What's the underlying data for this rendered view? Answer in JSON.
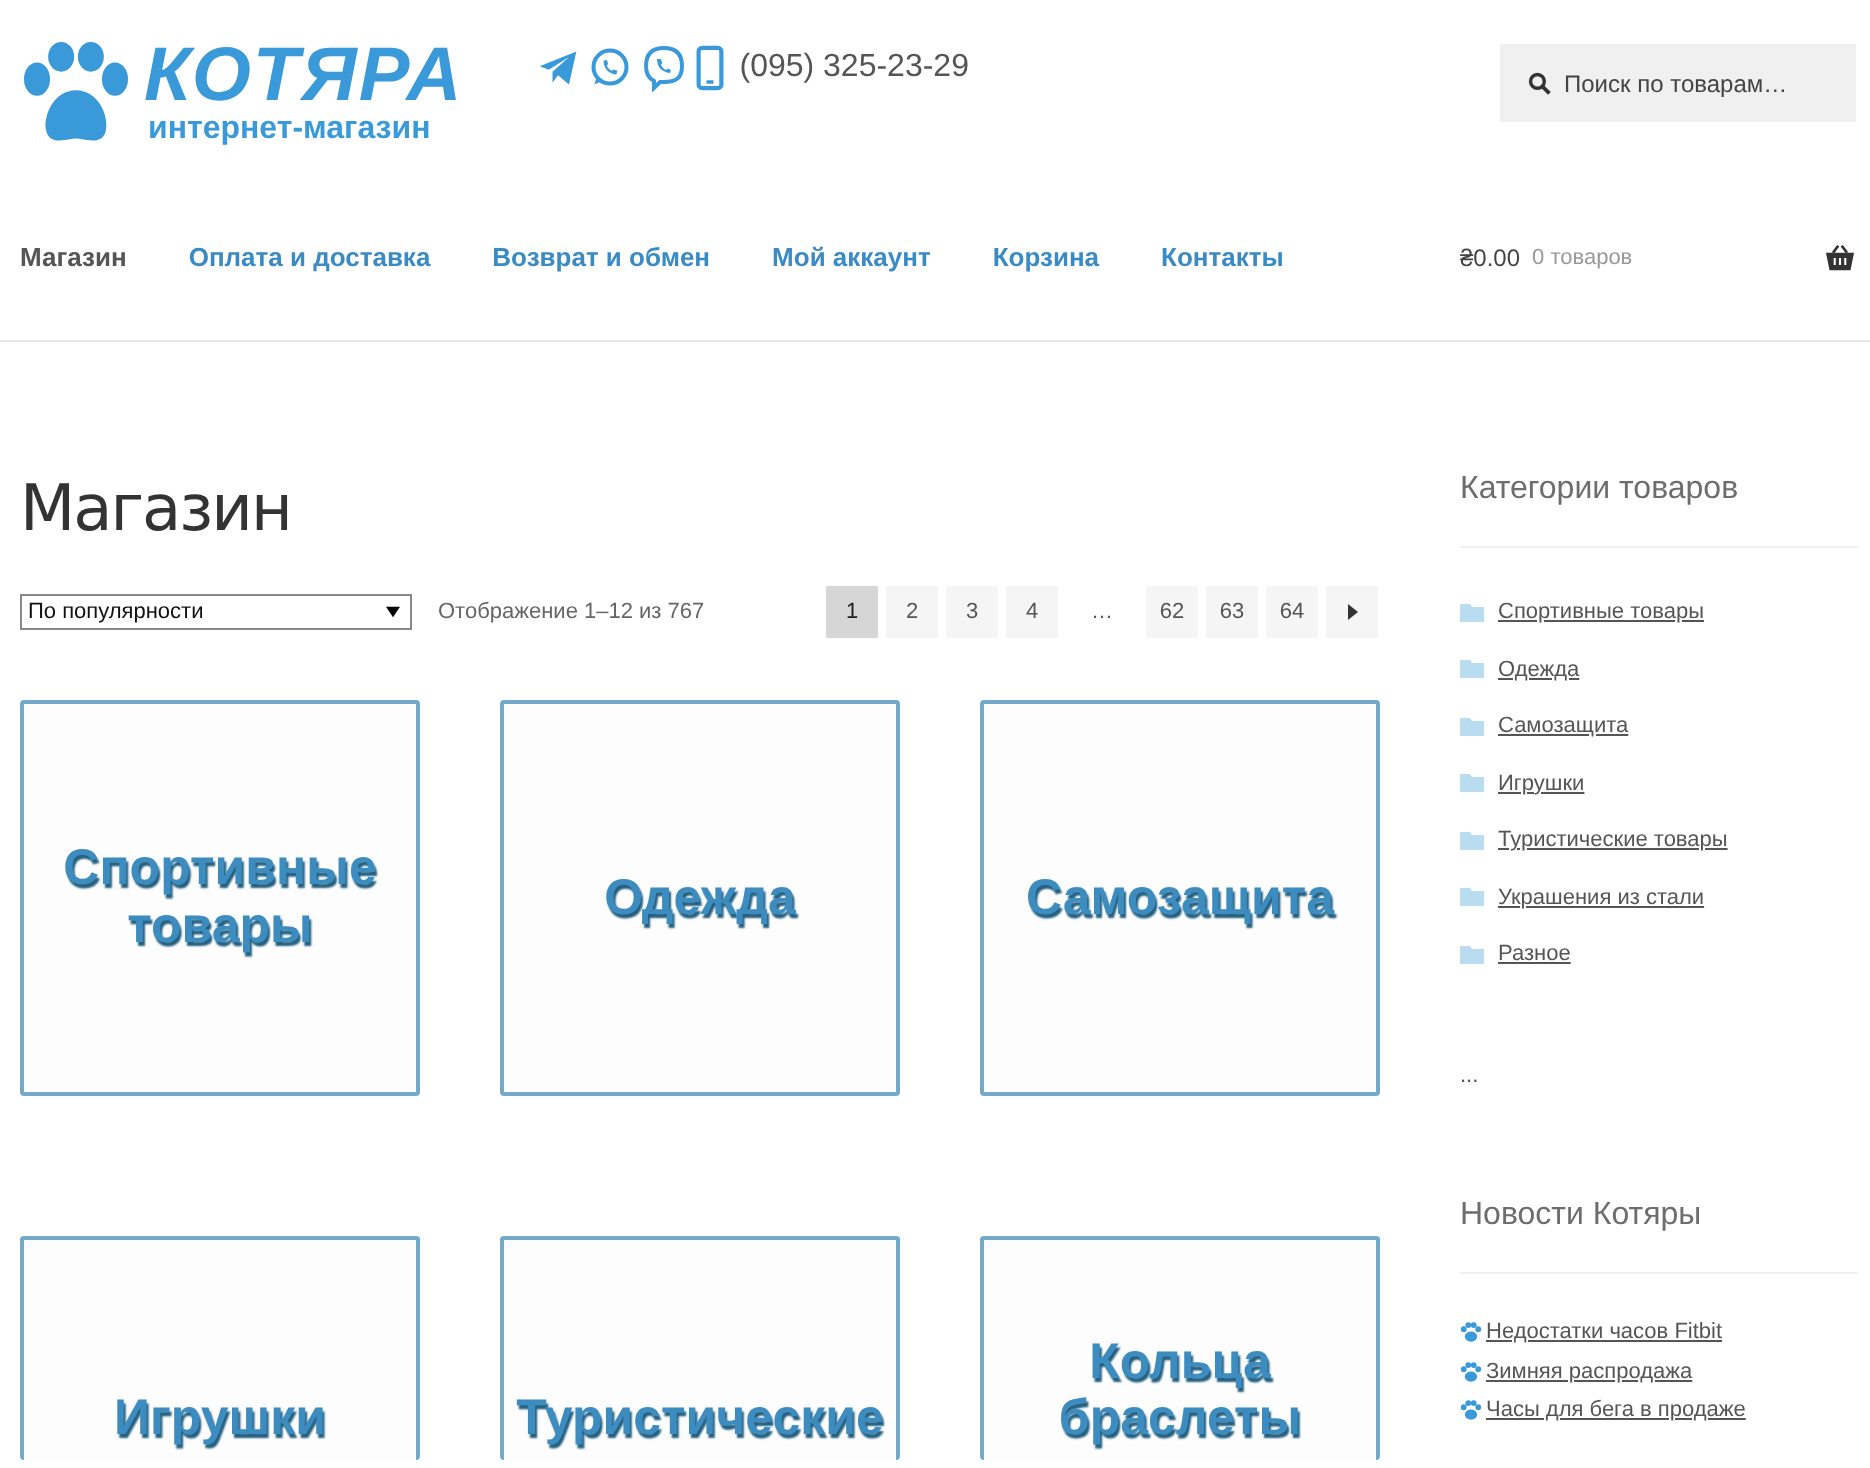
{
  "header": {
    "logo_title": "КОТЯРА",
    "logo_subtitle": "интернет-магазин",
    "phone": "(095) 325-23-29",
    "search": {
      "placeholder": "Поиск по товарам…"
    }
  },
  "nav": [
    {
      "label": "Магазин",
      "selected": true
    },
    {
      "label": "Оплата и доставка",
      "selected": false
    },
    {
      "label": "Возврат и обмен",
      "selected": false
    },
    {
      "label": "Мой аккаунт",
      "selected": false
    },
    {
      "label": "Корзина",
      "selected": false
    },
    {
      "label": "Контакты",
      "selected": false
    }
  ],
  "cart": {
    "total": "₴0.00",
    "count": "0 товаров"
  },
  "page_title": "Магазин",
  "sort": {
    "value": "По популярности"
  },
  "result_count": "Отображение 1–12 из 767",
  "pagination": [
    {
      "label": "1",
      "selected": true
    },
    {
      "label": "2",
      "selected": false
    },
    {
      "label": "3",
      "selected": false
    },
    {
      "label": "4",
      "selected": false
    },
    {
      "label": "…",
      "kind": "gap",
      "selected": false
    },
    {
      "label": "62",
      "selected": false
    },
    {
      "label": "63",
      "selected": false
    },
    {
      "label": "64",
      "selected": false
    }
  ],
  "products": [
    {
      "title": "Спортивные товары"
    },
    {
      "title": "Одежда"
    },
    {
      "title": "Самозащита"
    },
    {
      "title": "Игрушки"
    },
    {
      "title": "Туристические"
    },
    {
      "title": "Кольца браслеты"
    }
  ],
  "sidebar": {
    "categories_title": "Категории товаров",
    "categories": [
      "Спортивные товары",
      "Одежда",
      "Самозащита",
      "Игрушки",
      "Туристические товары",
      "Украшения из стали",
      "Разное"
    ],
    "more": "...",
    "news_title": "Новости Котяры",
    "news": [
      "Недостатки часов Fitbit",
      "Зимняя распродажа",
      "Часы для бега в продаже"
    ]
  }
}
